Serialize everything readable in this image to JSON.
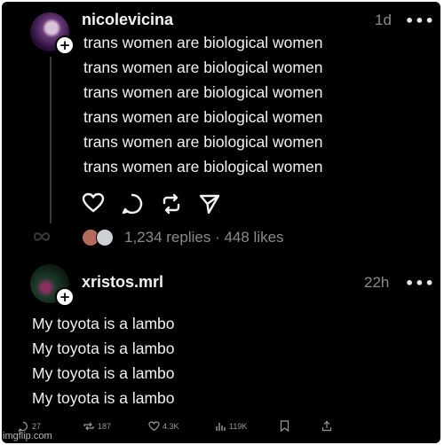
{
  "post": {
    "username": "nicolevicina",
    "time": "1d",
    "more_label": "•••",
    "lines": [
      "trans women are biological women",
      "trans women are biological women",
      "trans women are biological women",
      "trans women are biological women",
      "trans women are biological women",
      "trans women are biological women"
    ],
    "stats": "1,234 replies · 448 likes",
    "action_icons": [
      "heart-icon",
      "comment-icon",
      "repost-icon",
      "share-icon"
    ]
  },
  "reply": {
    "username": "xristos.mrl",
    "time": "22h",
    "more_label": "•••",
    "lines": [
      "My toyota is a lambo",
      "My toyota is a lambo",
      "My toyota is a lambo",
      "My toyota is a lambo"
    ],
    "bottom_bar": {
      "replies": "27",
      "reposts": "187",
      "likes": "4.3K",
      "views": "119K"
    }
  },
  "watermark": "imgflip.com",
  "colors": {
    "background": "#000000",
    "text": "#f2f2f2",
    "muted": "#8a8a8a"
  }
}
